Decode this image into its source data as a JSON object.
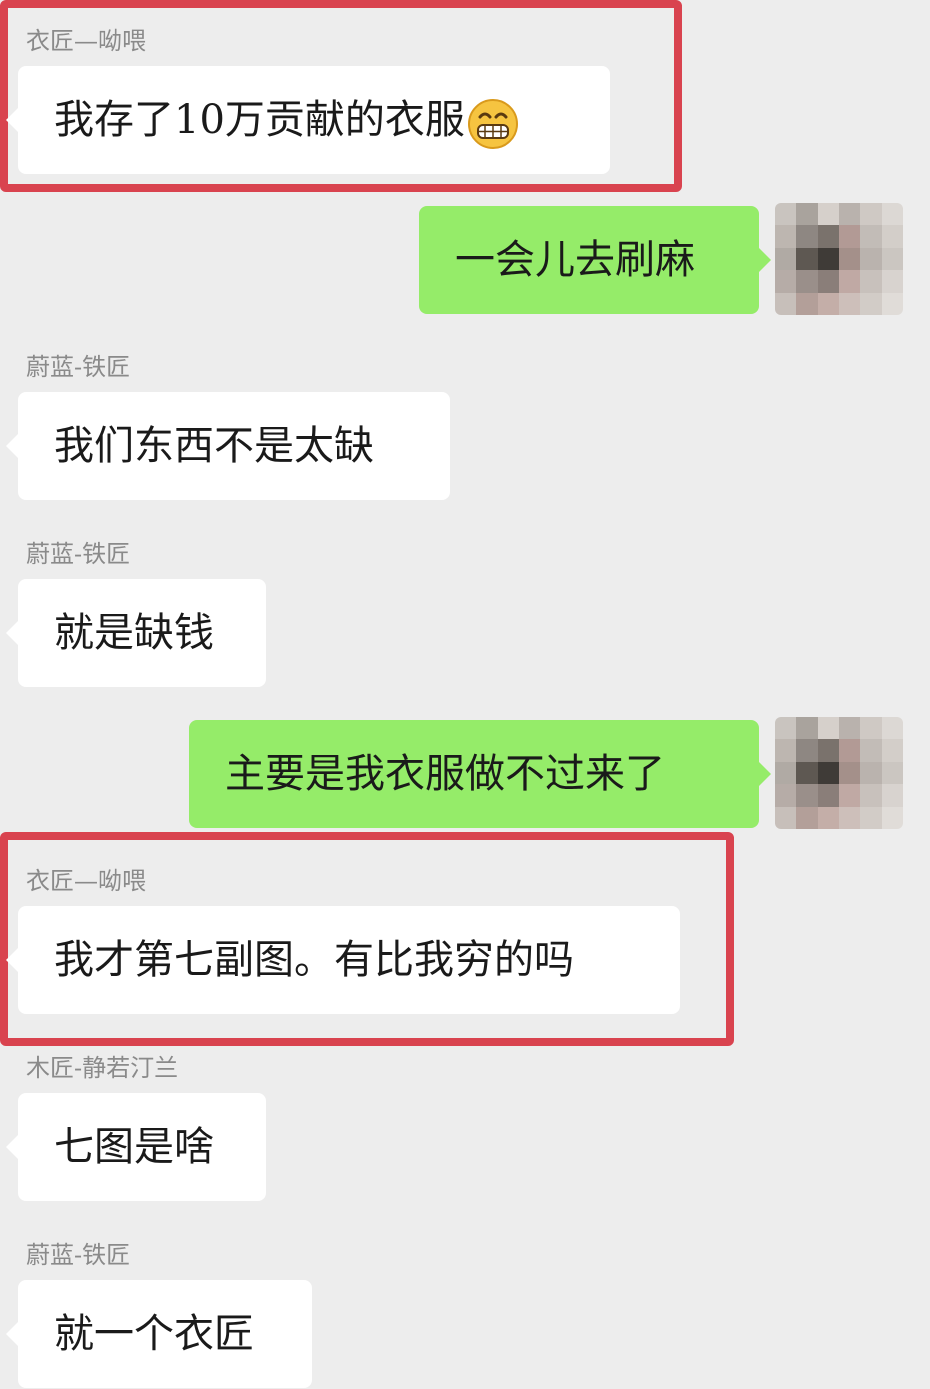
{
  "chat": {
    "messages": [
      {
        "sender": "衣匠—呦喂",
        "text": "我存了10万贡献的衣服",
        "emoji": "grinning-face-icon",
        "direction": "incoming"
      },
      {
        "sender": "",
        "text": "一会儿去刷麻",
        "direction": "outgoing"
      },
      {
        "sender": "蔚蓝-铁匠",
        "text": "我们东西不是太缺",
        "direction": "incoming"
      },
      {
        "sender": "蔚蓝-铁匠",
        "text": "就是缺钱",
        "direction": "incoming"
      },
      {
        "sender": "",
        "text": "主要是我衣服做不过来了",
        "direction": "outgoing"
      },
      {
        "sender": "衣匠—呦喂",
        "text": "我才第七副图。有比我穷的吗",
        "direction": "incoming"
      },
      {
        "sender": "木匠-静若汀兰",
        "text": "七图是啥",
        "direction": "incoming"
      },
      {
        "sender": "蔚蓝-铁匠",
        "text": "就一个衣匠",
        "direction": "incoming"
      }
    ]
  },
  "colors": {
    "background": "#ededed",
    "incoming_bubble": "#ffffff",
    "outgoing_bubble": "#95ec69",
    "highlight_box": "#d9434f"
  }
}
